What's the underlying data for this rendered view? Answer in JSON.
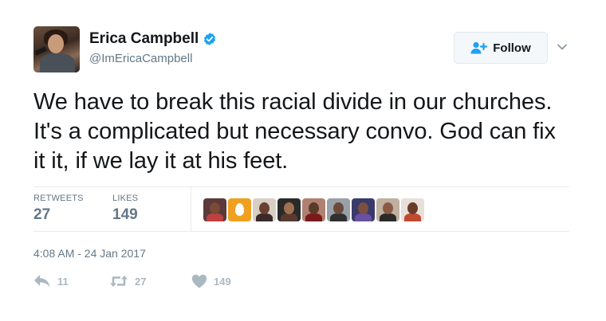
{
  "user": {
    "display_name": "Erica Campbell",
    "handle": "@ImEricaCampbell",
    "verified": true
  },
  "follow_button": {
    "label": "Follow"
  },
  "tweet": {
    "text": "We have to break this racial divide in our churches. It's a complicated but necessary convo. God can fix it it, if we lay it at his feet.",
    "timestamp": "4:08 AM - 24 Jan 2017"
  },
  "stats": {
    "retweets_label": "RETWEETS",
    "retweets_value": "27",
    "likes_label": "LIKES",
    "likes_value": "149",
    "liker_avatar_count": 9
  },
  "actions": {
    "reply_count": "11",
    "retweet_count": "27",
    "like_count": "149"
  },
  "colors": {
    "text_primary": "#14171a",
    "text_secondary": "#657786",
    "verified_blue": "#1da1f2",
    "follow_icon_blue": "#1da1f2",
    "action_gray": "#aab8c2",
    "divider": "#e6ecf0"
  },
  "icons": {
    "verified": "verified-badge-icon",
    "follow": "add-user-icon",
    "caret": "chevron-down-icon",
    "reply": "reply-icon",
    "retweet": "retweet-icon",
    "like": "heart-icon"
  }
}
